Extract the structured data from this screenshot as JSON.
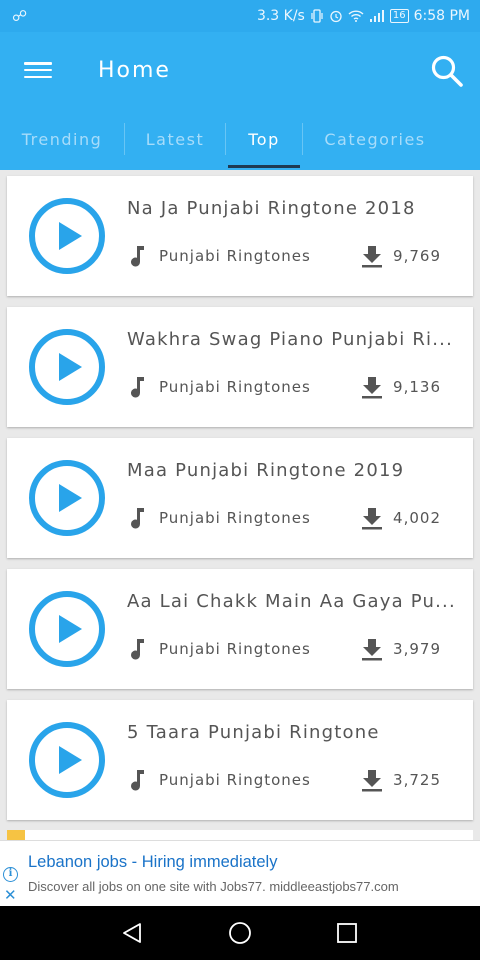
{
  "status_bar": {
    "speed": "3.3 K/s",
    "battery": "16",
    "time": "6:58 PM",
    "icons": [
      "usb-icon",
      "vibrate-icon",
      "alarm-icon",
      "wifi-icon",
      "signal-icon",
      "battery-icon"
    ]
  },
  "app_bar": {
    "title": "Home",
    "menu_icon": "hamburger-menu-icon",
    "search_icon": "search-icon"
  },
  "tabs": [
    {
      "label": "Trending",
      "active": false
    },
    {
      "label": "Latest",
      "active": false
    },
    {
      "label": "Top",
      "active": true
    },
    {
      "label": "Categories",
      "active": false
    }
  ],
  "ringtones": [
    {
      "title": "Na Ja Punjabi Ringtone 2018",
      "category": "Punjabi Ringtones",
      "downloads": "9,769"
    },
    {
      "title": "Wakhra Swag Piano Punjabi Ri...",
      "category": "Punjabi Ringtones",
      "downloads": "9,136"
    },
    {
      "title": "Maa Punjabi Ringtone 2019",
      "category": "Punjabi Ringtones",
      "downloads": "4,002"
    },
    {
      "title": "Aa Lai Chakk Main Aa Gaya Pu...",
      "category": "Punjabi Ringtones",
      "downloads": "3,979"
    },
    {
      "title": "5 Taara Punjabi Ringtone",
      "category": "Punjabi Ringtones",
      "downloads": "3,725"
    }
  ],
  "ad": {
    "title": "Lebanon jobs - Hiring immediately",
    "description": "Discover all jobs on one site with Jobs77. middleeastjobs77.com"
  },
  "colors": {
    "primary": "#33b0f2",
    "status_bar": "#2eaaee",
    "play_button": "#29a4ea",
    "tab_indicator": "#1f3a52",
    "ad_link": "#1a73c8"
  }
}
